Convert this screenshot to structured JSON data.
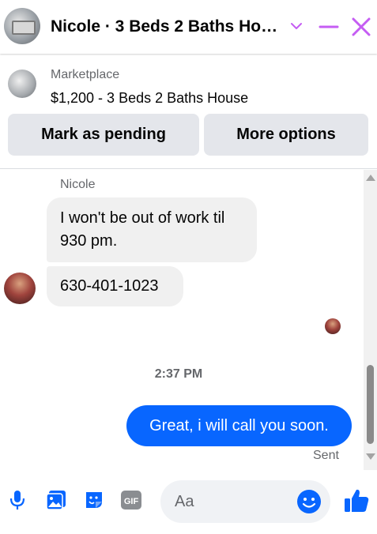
{
  "header": {
    "title": "Nicole · 3 Beds 2 Baths Ho…",
    "icons": [
      "chevron-down-icon",
      "minimize-icon",
      "close-icon"
    ],
    "accent_color": "#c55df3"
  },
  "listing": {
    "category": "Marketplace",
    "title": "$1,200 - 3 Beds 2 Baths House",
    "buttons": {
      "pending": "Mark as pending",
      "more": "More options"
    }
  },
  "thread": {
    "sender_name": "Nicole",
    "incoming": [
      "I won't be out of work til 930 pm.",
      "630-401-1023"
    ],
    "timestamp": "2:37 PM",
    "outgoing": "Great, i will call you soon.",
    "status": "Sent"
  },
  "composer": {
    "placeholder": "Aa",
    "gif_label": "GIF",
    "icons": [
      "microphone-icon",
      "photo-icon",
      "sticker-icon",
      "gif-icon",
      "emoji-icon",
      "like-icon"
    ],
    "brand_color": "#0866ff"
  }
}
